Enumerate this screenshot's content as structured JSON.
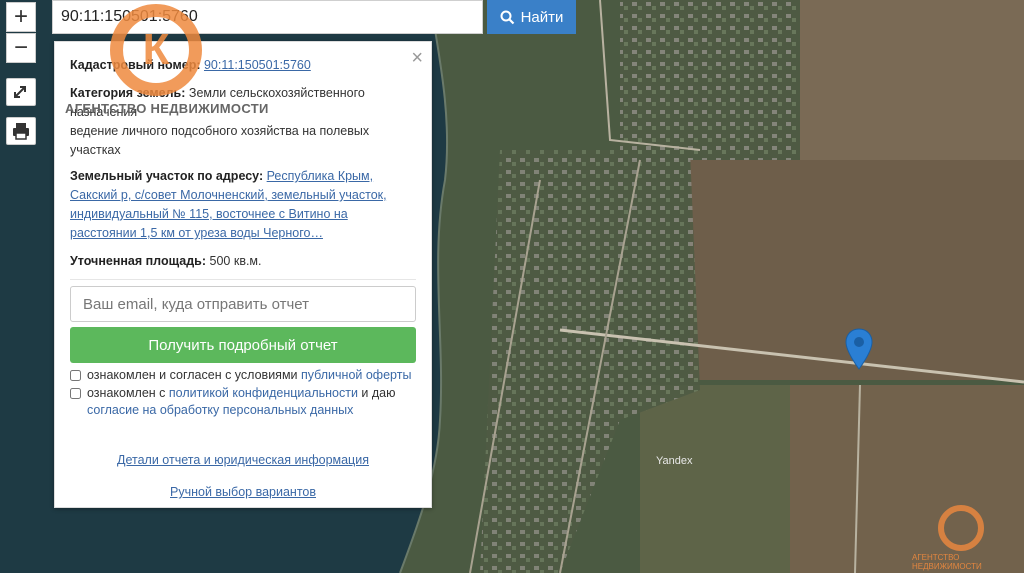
{
  "search": {
    "value": "90:11:150501:5760",
    "button_label": "Найти"
  },
  "zoom": {
    "in_label": "+",
    "out_label": "−"
  },
  "popup": {
    "close_label": "×",
    "cadastral": {
      "label": "Кадастровый номер:",
      "value": "90:11:150501:5760"
    },
    "category": {
      "label": "Категория земель:",
      "value": "Земли сельскохозяйственного назначения",
      "usage": "ведение личного подсобного хозяйства на полевых участках"
    },
    "address": {
      "label": "Земельный участок по адресу:",
      "value": "Республика Крым, Сакский р, с/совет Молочненский, земельный участок, индивидуальный № 115, восточнее с Витино на расстоянии 1,5 км от уреза воды Черного…"
    },
    "area": {
      "label": "Уточненная площадь:",
      "value": "500 кв.м."
    },
    "email_placeholder": "Ваш email, куда отправить отчет",
    "report_button": "Получить подробный отчет",
    "consent1": {
      "text": "ознакомлен и согласен с условиями ",
      "link": "публичной оферты"
    },
    "consent2": {
      "text": "ознакомлен с ",
      "link1": "политикой конфиденциальности",
      "mid": " и даю ",
      "link2": "согласие на обработку персональных данных"
    },
    "details_link": "Детали отчета и юридическая информация",
    "manual_link": "Ручной выбор вариантов"
  },
  "watermark": {
    "agency_text": "АГЕНТСТВО НЕДВИЖИМОСТИ",
    "logo_letter": "К",
    "small_text": "АГЕНТСТВО НЕДВИЖИМОСТИ"
  },
  "map": {
    "attribution": "Yandex"
  },
  "colors": {
    "accent_blue": "#3a80c8",
    "green_button": "#5cb85c",
    "pin_blue": "#2a7fd4",
    "logo_orange": "#ef8a3e"
  }
}
